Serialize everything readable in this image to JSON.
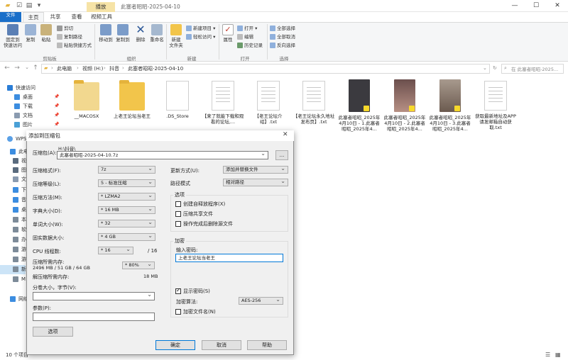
{
  "window": {
    "title": "此塞者昭昭-2025-04-10",
    "manage_tab": "播放",
    "controls": [
      "—",
      "☐",
      "✕"
    ]
  },
  "ribbon": {
    "tabs": [
      "文件",
      "主页",
      "共享",
      "查看",
      "视频工具"
    ],
    "clipboard": {
      "pin": "固定到\n快速访问",
      "copy": "复制",
      "paste": "粘贴",
      "cut": "剪切",
      "copy_path": "复制路径",
      "paste_shortcut": "粘贴快捷方式",
      "label": "剪贴板"
    },
    "organize": {
      "move_to": "移动到",
      "copy_to": "复制到",
      "delete": "删除",
      "rename": "重命名",
      "label": "组织"
    },
    "new": {
      "new_folder": "新建\n文件夹",
      "new_item": "新建项目 ▾",
      "easy_access": "轻松访问 ▾",
      "label": "新建"
    },
    "open": {
      "properties": "属性",
      "open": "打开 ▾",
      "edit": "编辑",
      "history": "历史记录",
      "label": "打开"
    },
    "select": {
      "select_all": "全部选择",
      "select_none": "全部取消",
      "invert": "反向选择",
      "label": "选择"
    }
  },
  "address": {
    "crumbs": [
      "此电脑",
      "视频 (H:)",
      "抖音",
      "此塞者昭昭-2025-04-10"
    ],
    "search_placeholder": "在 此塞者昭昭-2025..."
  },
  "sidebar": {
    "items": [
      "快速访问",
      "桌面",
      "下载",
      "文档",
      "图片",
      "WPS",
      "此电",
      "视",
      "图",
      "文",
      "下",
      "音",
      "桌",
      "本",
      "软",
      "办",
      "游",
      "游",
      "新",
      "M",
      "网络"
    ]
  },
  "files": [
    {
      "name": "__MACOSX",
      "type": "folder"
    },
    {
      "name": "上老王论坛当老王",
      "type": "folder"
    },
    {
      "name": ".DS_Store",
      "type": "doc"
    },
    {
      "name": "【来了就能下载和观看的论坛,...",
      "type": "doc"
    },
    {
      "name": "【老王论坛介绍】.txt",
      "type": "doc"
    },
    {
      "name": "【老王论坛永久地址发布页】.txt",
      "type": "doc"
    },
    {
      "name": "此塞者昭昭_2025年4月10日 - 1.此塞者昭昭_2025年4...",
      "type": "photo",
      "color": "#3b3a3f"
    },
    {
      "name": "此塞者昭昭_2025年4月10日 - 2.此塞者昭昭_2025年4...",
      "type": "photo",
      "color": "#7a5d5a"
    },
    {
      "name": "此塞者昭昭_2025年4月10日 - 3.此塞者昭昭_2025年4...",
      "type": "photo",
      "color": "#8b7a6e"
    },
    {
      "name": "获取最新地址及APP请发邮箱自动获取.txt",
      "type": "doc"
    }
  ],
  "status": "10 个项目",
  "dialog": {
    "title": "添加到压缩包",
    "archive_label": "压缩包(A):",
    "archive_dir": "H:\\抖音\\",
    "archive_name": "此塞者昭昭-2025-04-10.7z",
    "browse": "...",
    "format_label": "压缩格式(F):",
    "format": "7z",
    "level_label": "压缩等级(L):",
    "level": "5 - 标准压缩",
    "method_label": "压缩方法(M):",
    "method": "* LZMA2",
    "dict_label": "字典大小(D):",
    "dict": "* 16 MB",
    "word_label": "单词大小(W):",
    "word": "* 32",
    "solid_label": "固实数据大小:",
    "solid": "* 4 GB",
    "threads_label": "CPU 线程数:",
    "threads": "* 16",
    "threads_max": "/ 16",
    "mem_label": "压缩所需内存:",
    "mem_value": "2496 MB / 51 GB / 64 GB",
    "mem_pct": "* 80%",
    "demem_label": "解压缩所需内存:",
    "demem_value": "18 MB",
    "split_label": "分卷大小，字节(V):",
    "params_label": "参数(P):",
    "options_btn": "选项",
    "update_label": "更新方式(U):",
    "update": "添加并替换文件",
    "path_label": "路径模式",
    "path": "相对路径",
    "opt_group": "选项",
    "opt_sfx": "创建自释放程序(X)",
    "opt_shared": "压缩共享文件",
    "opt_delete": "操作完成后删除源文件",
    "enc_group": "加密",
    "pwd_label": "输入密码:",
    "pwd_value": "上老王论坛当老王",
    "show_pwd": "显示密码(S)",
    "enc_method_label": "加密算法:",
    "enc_method": "AES-256",
    "enc_names": "加密文件名(N)",
    "ok": "确定",
    "cancel": "取消",
    "help": "帮助"
  }
}
